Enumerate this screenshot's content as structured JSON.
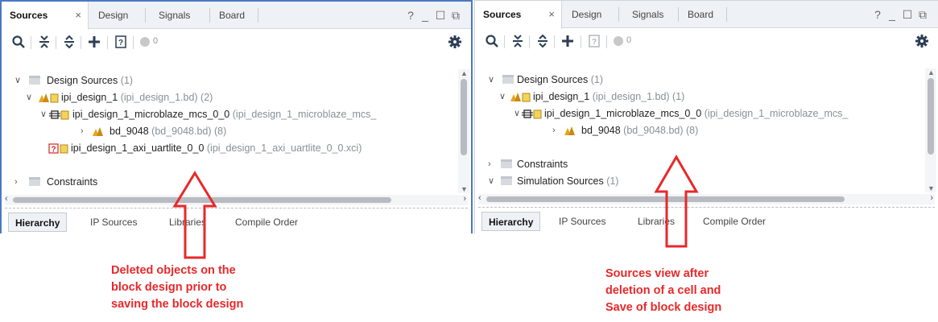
{
  "panels": [
    {
      "id": "left",
      "tabs": [
        "Sources",
        "Design",
        "Signals",
        "Board"
      ],
      "tab_close": "×",
      "window_buttons": [
        "?",
        "_",
        "☐",
        "⧉"
      ],
      "warning_count": "0",
      "tree": [
        {
          "label": "Design Sources",
          "sub": "(1)",
          "chev": "∨",
          "icon": "folder-icon"
        },
        {
          "label": "ipi_design_1",
          "sub": "(ipi_design_1.bd) (2)",
          "chev": "∨",
          "icon": "block-design-icon"
        },
        {
          "label": "ipi_design_1_microblaze_mcs_0_0",
          "sub": "(ipi_design_1_microblaze_mcs_",
          "chev": "∨",
          "icon": "ip-core-icon"
        },
        {
          "label": "bd_9048",
          "sub": "(bd_9048.bd) (8)",
          "chev": "›",
          "icon": "bd-hier-icon"
        },
        {
          "label": "ipi_design_1_axi_uartlite_0_0",
          "sub": "(ipi_design_1_axi_uartlite_0_0.xci)",
          "chev": "",
          "icon": "missing-ip-icon"
        },
        {
          "label": "Constraints",
          "sub": "",
          "chev": "›",
          "icon": "folder-icon"
        }
      ],
      "bottom_tabs": [
        "Hierarchy",
        "IP Sources",
        "Libraries",
        "Compile Order"
      ]
    },
    {
      "id": "right",
      "tabs": [
        "Sources",
        "Design",
        "Signals",
        "Board"
      ],
      "tab_close": "×",
      "window_buttons": [
        "?",
        "_",
        "☐",
        "⧉"
      ],
      "warning_count": "0",
      "tree": [
        {
          "label": "Design Sources",
          "sub": "(1)",
          "chev": "∨",
          "icon": "folder-icon"
        },
        {
          "label": "ipi_design_1",
          "sub": "(ipi_design_1.bd) (1)",
          "chev": "∨",
          "icon": "block-design-icon"
        },
        {
          "label": "ipi_design_1_microblaze_mcs_0_0",
          "sub": "(ipi_design_1_microblaze_mcs_",
          "chev": "∨",
          "icon": "ip-core-icon"
        },
        {
          "label": "bd_9048",
          "sub": "(bd_9048.bd) (8)",
          "chev": "›",
          "icon": "bd-hier-icon"
        },
        {
          "label": "Constraints",
          "sub": "",
          "chev": "›",
          "icon": "folder-icon"
        },
        {
          "label": "Simulation Sources",
          "sub": "(1)",
          "chev": "∨",
          "icon": "folder-icon"
        }
      ],
      "bottom_tabs": [
        "Hierarchy",
        "IP Sources",
        "Libraries",
        "Compile Order"
      ]
    }
  ],
  "annotations": {
    "left_caption": [
      "Deleted objects on the",
      "block design prior to",
      "saving the block design"
    ],
    "right_caption": [
      "Sources view after",
      "deletion of a cell and",
      "Save of block design"
    ],
    "color": "#e8282a"
  }
}
